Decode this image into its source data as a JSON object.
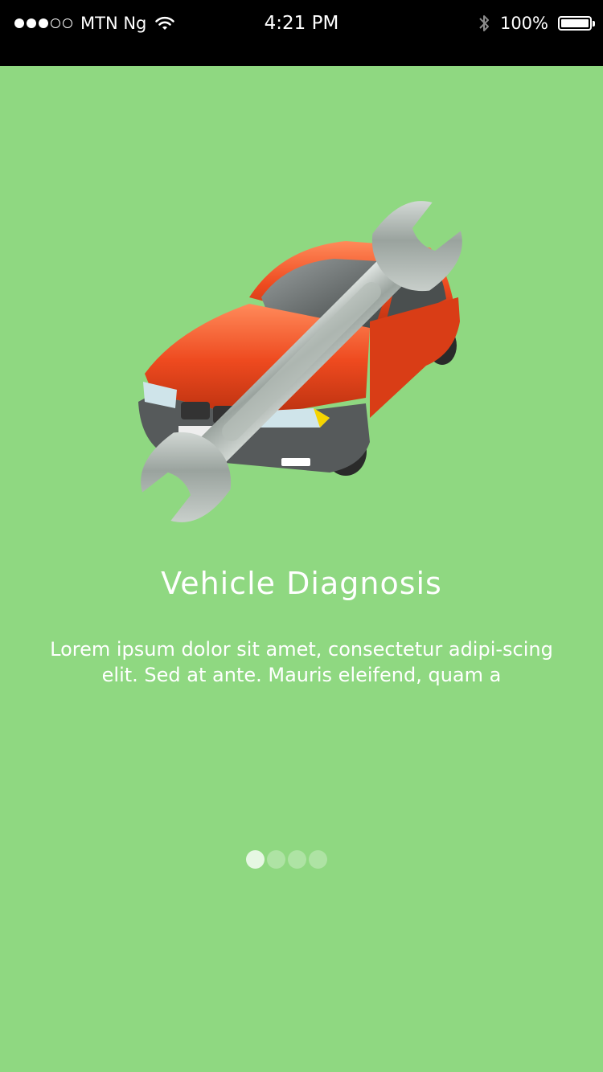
{
  "status_bar": {
    "carrier": "MTN Ng",
    "time": "4:21 PM",
    "battery": "100%",
    "signal_strength_of_5": 3
  },
  "onboarding": {
    "title": "Vehicle Diagnosis",
    "description": "Lorem ipsum dolor sit amet, consectetur adipi-scing elit. Sed at ante. Mauris eleifend, quam a",
    "page_count": 4,
    "current_page": 1
  },
  "icons": {
    "hero": "car-wrench-icon",
    "wifi": "wifi-icon",
    "bluetooth": "bluetooth-icon",
    "battery": "battery-icon"
  },
  "colors": {
    "background": "#8fd881",
    "car_body": "#ee4a1f",
    "wrench": "#a9b2ad"
  }
}
